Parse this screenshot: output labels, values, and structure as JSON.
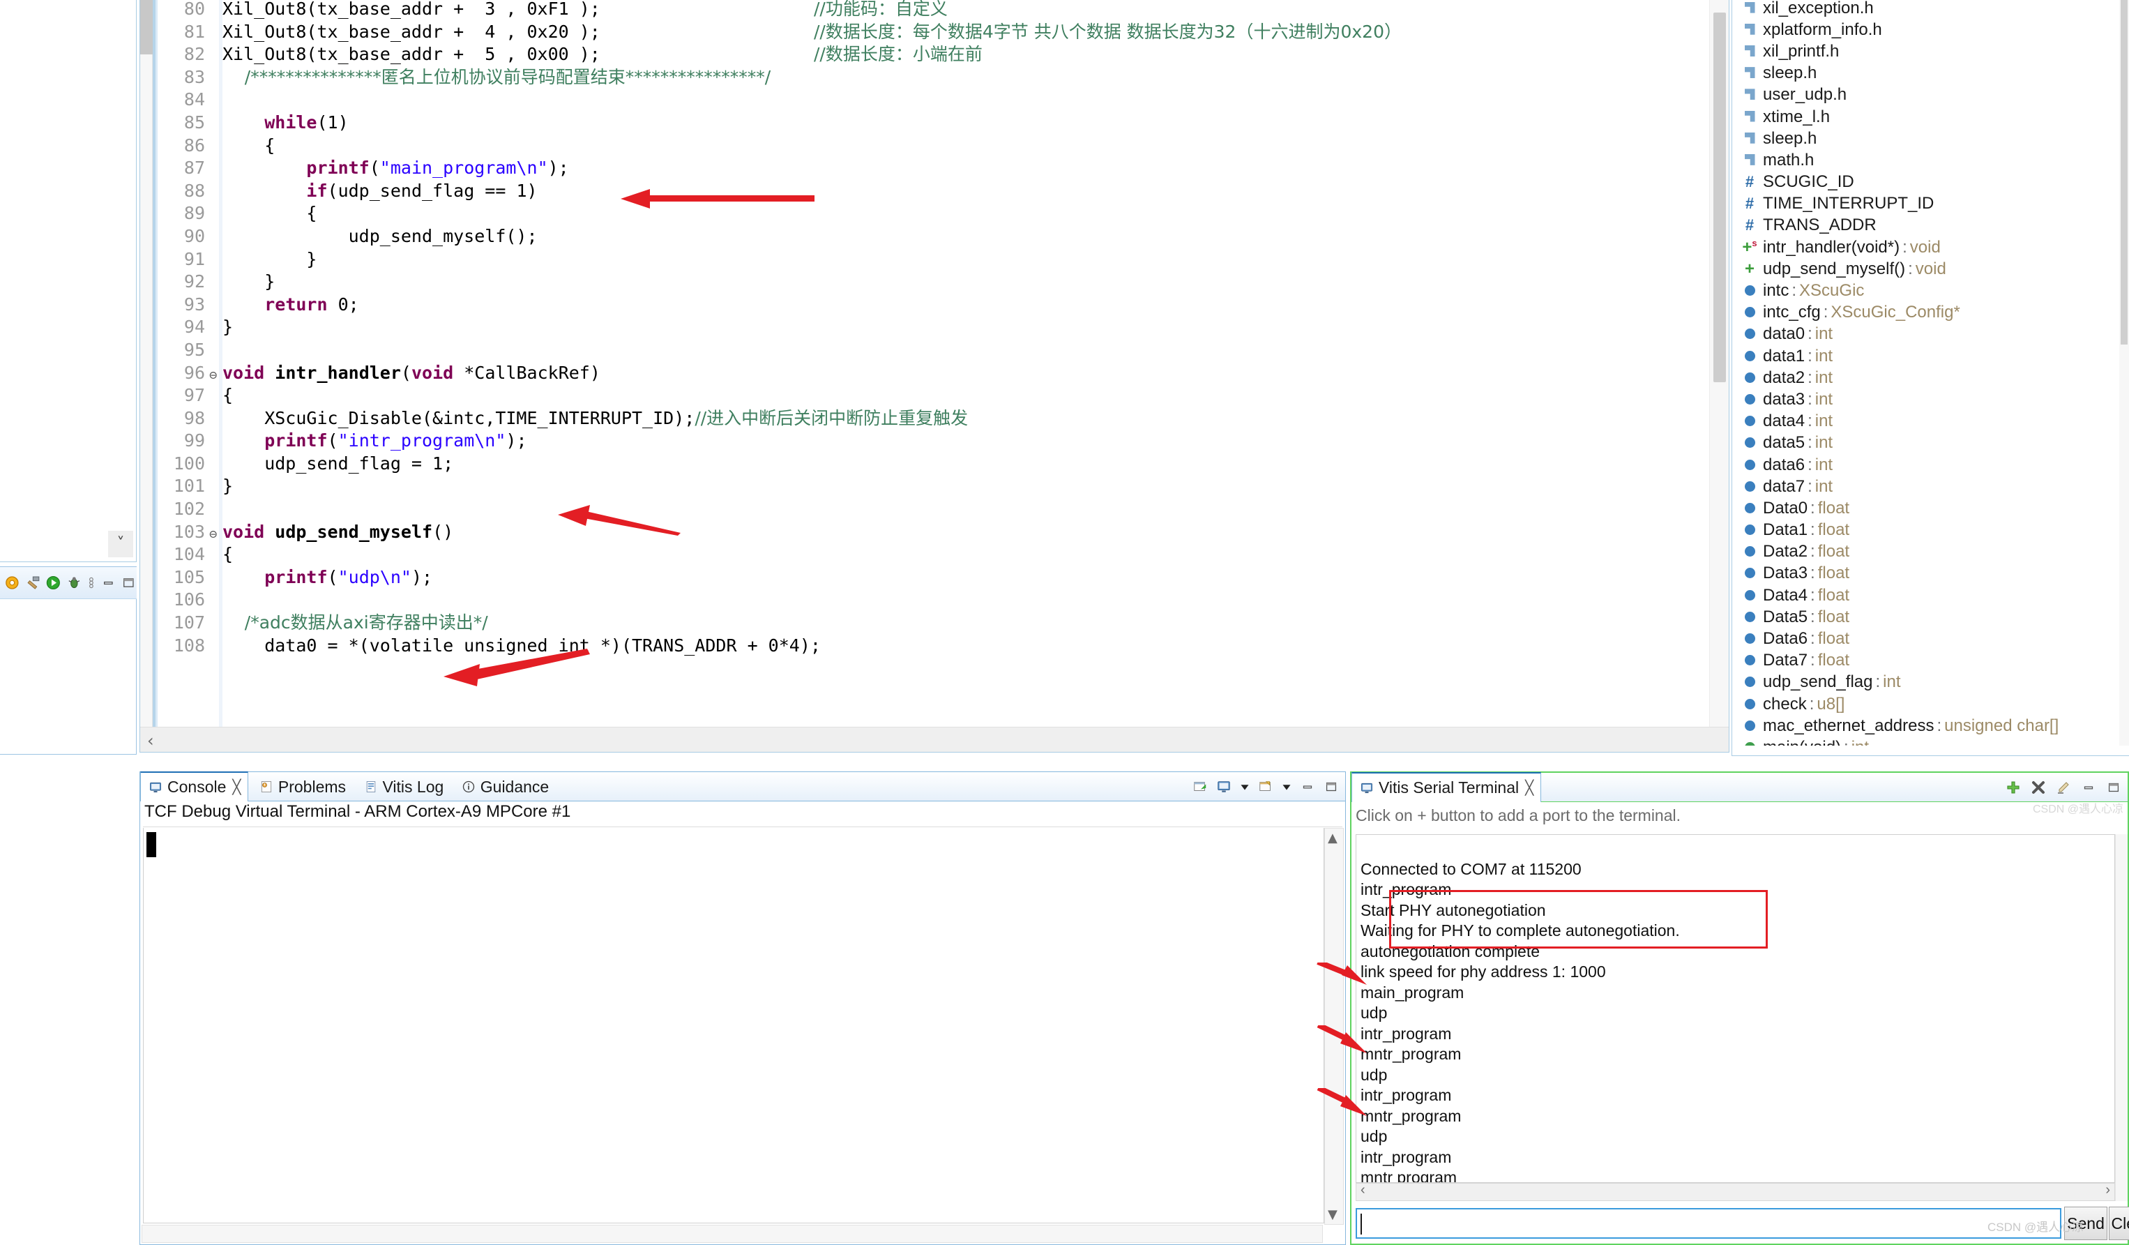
{
  "editor": {
    "lines": [
      {
        "num": "80",
        "fold": "",
        "segments": [
          {
            "t": "Xil_Out8(tx_base_addr +  3 , 0xF1 );",
            "c": "plain"
          }
        ],
        "comment": "//功能码：自定义"
      },
      {
        "num": "81",
        "fold": "",
        "segments": [
          {
            "t": "Xil_Out8(tx_base_addr +  4 , 0x20 );",
            "c": "plain"
          }
        ],
        "comment": "//数据长度：每个数据4字节 共八个数据 数据长度为32（十六进制为0x20）"
      },
      {
        "num": "82",
        "fold": "",
        "segments": [
          {
            "t": "Xil_Out8(tx_base_addr +  5 , 0x00 );",
            "c": "plain"
          }
        ],
        "comment": "//数据长度：小端在前"
      },
      {
        "num": "83",
        "fold": "",
        "segments": [
          {
            "t": "    /***************匿名上位机协议前导码配置结束****************/",
            "c": "cmt"
          }
        ],
        "comment": ""
      },
      {
        "num": "84",
        "fold": "",
        "segments": [],
        "comment": ""
      },
      {
        "num": "85",
        "fold": "",
        "segments": [
          {
            "t": "    ",
            "c": "plain"
          },
          {
            "t": "while",
            "c": "kw"
          },
          {
            "t": "(1)",
            "c": "plain"
          }
        ],
        "comment": ""
      },
      {
        "num": "86",
        "fold": "",
        "segments": [
          {
            "t": "    {",
            "c": "plain"
          }
        ],
        "comment": ""
      },
      {
        "num": "87",
        "fold": "",
        "segments": [
          {
            "t": "        ",
            "c": "plain"
          },
          {
            "t": "printf",
            "c": "kw"
          },
          {
            "t": "(",
            "c": "plain"
          },
          {
            "t": "\"main_program\\n\"",
            "c": "str"
          },
          {
            "t": ");",
            "c": "plain"
          }
        ],
        "comment": ""
      },
      {
        "num": "88",
        "fold": "",
        "segments": [
          {
            "t": "        ",
            "c": "plain"
          },
          {
            "t": "if",
            "c": "kw"
          },
          {
            "t": "(udp_send_flag == 1)",
            "c": "plain"
          }
        ],
        "comment": ""
      },
      {
        "num": "89",
        "fold": "",
        "segments": [
          {
            "t": "        {",
            "c": "plain"
          }
        ],
        "comment": ""
      },
      {
        "num": "90",
        "fold": "",
        "segments": [
          {
            "t": "            udp_send_myself();",
            "c": "plain"
          }
        ],
        "comment": ""
      },
      {
        "num": "91",
        "fold": "",
        "segments": [
          {
            "t": "        }",
            "c": "plain"
          }
        ],
        "comment": ""
      },
      {
        "num": "92",
        "fold": "",
        "segments": [
          {
            "t": "    }",
            "c": "plain"
          }
        ],
        "comment": ""
      },
      {
        "num": "93",
        "fold": "",
        "segments": [
          {
            "t": "    ",
            "c": "plain"
          },
          {
            "t": "return",
            "c": "kw"
          },
          {
            "t": " 0;",
            "c": "plain"
          }
        ],
        "comment": ""
      },
      {
        "num": "94",
        "fold": "",
        "segments": [
          {
            "t": "}",
            "c": "plain"
          }
        ],
        "comment": ""
      },
      {
        "num": "95",
        "fold": "",
        "segments": [],
        "comment": ""
      },
      {
        "num": "96",
        "fold": "⊖",
        "segments": [
          {
            "t": "void",
            "c": "kw"
          },
          {
            "t": " ",
            "c": "plain"
          },
          {
            "t": "intr_handler",
            "c": "bold"
          },
          {
            "t": "(",
            "c": "plain"
          },
          {
            "t": "void",
            "c": "kw"
          },
          {
            "t": " *CallBackRef)",
            "c": "plain"
          }
        ],
        "comment": ""
      },
      {
        "num": "97",
        "fold": "",
        "segments": [
          {
            "t": "{",
            "c": "plain"
          }
        ],
        "comment": ""
      },
      {
        "num": "98",
        "fold": "",
        "segments": [
          {
            "t": "    XScuGic_Disable(&intc,TIME_INTERRUPT_ID);",
            "c": "plain"
          },
          {
            "t": "//进入中断后关闭中断防止重复触发",
            "c": "cmt"
          }
        ],
        "comment": ""
      },
      {
        "num": "99",
        "fold": "",
        "segments": [
          {
            "t": "    ",
            "c": "plain"
          },
          {
            "t": "printf",
            "c": "kw"
          },
          {
            "t": "(",
            "c": "plain"
          },
          {
            "t": "\"intr_program\\n\"",
            "c": "str"
          },
          {
            "t": ");",
            "c": "plain"
          }
        ],
        "comment": ""
      },
      {
        "num": "100",
        "fold": "",
        "segments": [
          {
            "t": "    udp_send_flag = 1;",
            "c": "plain"
          }
        ],
        "comment": ""
      },
      {
        "num": "101",
        "fold": "",
        "segments": [
          {
            "t": "}",
            "c": "plain"
          }
        ],
        "comment": ""
      },
      {
        "num": "102",
        "fold": "",
        "segments": [],
        "comment": ""
      },
      {
        "num": "103",
        "fold": "⊖",
        "segments": [
          {
            "t": "void",
            "c": "kw"
          },
          {
            "t": " ",
            "c": "plain"
          },
          {
            "t": "udp_send_myself",
            "c": "bold"
          },
          {
            "t": "()",
            "c": "plain"
          }
        ],
        "comment": ""
      },
      {
        "num": "104",
        "fold": "",
        "segments": [
          {
            "t": "{",
            "c": "plain"
          }
        ],
        "comment": ""
      },
      {
        "num": "105",
        "fold": "",
        "segments": [
          {
            "t": "    ",
            "c": "plain"
          },
          {
            "t": "printf",
            "c": "kw"
          },
          {
            "t": "(",
            "c": "plain"
          },
          {
            "t": "\"udp\\n\"",
            "c": "str"
          },
          {
            "t": ");",
            "c": "plain"
          }
        ],
        "comment": ""
      },
      {
        "num": "106",
        "fold": "",
        "segments": [],
        "comment": ""
      },
      {
        "num": "107",
        "fold": "",
        "segments": [
          {
            "t": "    /*adc数据从axi寄存器中读出*/",
            "c": "cmt"
          }
        ],
        "comment": ""
      },
      {
        "num": "108",
        "fold": "",
        "segments": [
          {
            "t": "    data0 = *(volatile unsigned int *)(TRANS_ADDR + 0*4);",
            "c": "plain"
          }
        ],
        "comment": ""
      }
    ]
  },
  "outline": {
    "items": [
      {
        "icon": "header-icon",
        "name": "xil_exception.h",
        "type": ""
      },
      {
        "icon": "header-icon",
        "name": "xplatform_info.h",
        "type": ""
      },
      {
        "icon": "header-icon",
        "name": "xil_printf.h",
        "type": ""
      },
      {
        "icon": "header-icon",
        "name": "sleep.h",
        "type": ""
      },
      {
        "icon": "header-icon",
        "name": "user_udp.h",
        "type": ""
      },
      {
        "icon": "header-icon",
        "name": "xtime_l.h",
        "type": ""
      },
      {
        "icon": "header-icon",
        "name": "sleep.h",
        "type": ""
      },
      {
        "icon": "header-icon",
        "name": "math.h",
        "type": ""
      },
      {
        "icon": "define-icon",
        "name": "SCUGIC_ID",
        "type": ""
      },
      {
        "icon": "define-icon",
        "name": "TIME_INTERRUPT_ID",
        "type": ""
      },
      {
        "icon": "define-icon",
        "name": "TRANS_ADDR",
        "type": ""
      },
      {
        "icon": "function-static-icon",
        "name": "intr_handler(void*)",
        "type": "void"
      },
      {
        "icon": "function-icon",
        "name": "udp_send_myself()",
        "type": "void"
      },
      {
        "icon": "variable-icon",
        "name": "intc",
        "type": "XScuGic"
      },
      {
        "icon": "variable-icon",
        "name": "intc_cfg",
        "type": "XScuGic_Config*"
      },
      {
        "icon": "variable-icon",
        "name": "data0",
        "type": "int"
      },
      {
        "icon": "variable-icon",
        "name": "data1",
        "type": "int"
      },
      {
        "icon": "variable-icon",
        "name": "data2",
        "type": "int"
      },
      {
        "icon": "variable-icon",
        "name": "data3",
        "type": "int"
      },
      {
        "icon": "variable-icon",
        "name": "data4",
        "type": "int"
      },
      {
        "icon": "variable-icon",
        "name": "data5",
        "type": "int"
      },
      {
        "icon": "variable-icon",
        "name": "data6",
        "type": "int"
      },
      {
        "icon": "variable-icon",
        "name": "data7",
        "type": "int"
      },
      {
        "icon": "variable-icon",
        "name": "Data0",
        "type": "float"
      },
      {
        "icon": "variable-icon",
        "name": "Data1",
        "type": "float"
      },
      {
        "icon": "variable-icon",
        "name": "Data2",
        "type": "float"
      },
      {
        "icon": "variable-icon",
        "name": "Data3",
        "type": "float"
      },
      {
        "icon": "variable-icon",
        "name": "Data4",
        "type": "float"
      },
      {
        "icon": "variable-icon",
        "name": "Data5",
        "type": "float"
      },
      {
        "icon": "variable-icon",
        "name": "Data6",
        "type": "float"
      },
      {
        "icon": "variable-icon",
        "name": "Data7",
        "type": "float"
      },
      {
        "icon": "variable-icon",
        "name": "udp_send_flag",
        "type": "int"
      },
      {
        "icon": "variable-icon",
        "name": "check",
        "type": "u8[]"
      },
      {
        "icon": "variable-icon",
        "name": "mac_ethernet_address",
        "type": "unsigned char[]"
      },
      {
        "icon": "function-main-icon",
        "name": "main(void)",
        "type": "int"
      }
    ]
  },
  "console": {
    "tabs": [
      {
        "label": "Console",
        "icon": "console-icon",
        "active": true,
        "closable": true
      },
      {
        "label": "Problems",
        "icon": "problems-icon",
        "active": false,
        "closable": false
      },
      {
        "label": "Vitis Log",
        "icon": "log-icon",
        "active": false,
        "closable": false
      },
      {
        "label": "Guidance",
        "icon": "info-icon",
        "active": false,
        "closable": false
      }
    ],
    "subtitle": "TCF Debug Virtual Terminal - ARM Cortex-A9 MPCore #1",
    "body_text": "",
    "toolbar_icons": [
      "terminate-icon",
      "display-console-icon",
      "display-console-dropdown-icon",
      "open-console-icon",
      "open-console-dropdown-icon",
      "minimize-icon",
      "maximize-icon"
    ]
  },
  "left_panel": {
    "toolbar_icons": [
      "settings-icon",
      "build-icon",
      "run-icon",
      "debug-icon",
      "menu-icon",
      "minimize-icon",
      "maximize-icon"
    ],
    "collapse_icon": "chevron-down-icon"
  },
  "serial": {
    "tab": {
      "label": "Vitis Serial Terminal",
      "icon": "terminal-icon",
      "closable": true
    },
    "hint": "Click on + button to add a port to the terminal.",
    "output_lines": [
      "",
      "Connected to COM7 at 115200",
      "intr_program",
      "Start PHY autonegotiation",
      "Waiting for PHY to complete autonegotiation.",
      "autonegotiation complete",
      "link speed for phy address 1: 1000",
      "main_program",
      "udp",
      "intr_program",
      "mntr_program",
      "udp",
      "intr_program",
      "mntr_program",
      "udp",
      "intr_program",
      "mntr program"
    ],
    "input_value": "",
    "send_label": "Send",
    "clear_label": "Clear",
    "toolbar_icons": [
      "add-port-icon",
      "disconnect-icon",
      "clear-terminal-icon",
      "minimize-icon",
      "maximize-icon"
    ]
  },
  "annotations": {
    "highlight_box_label": "phy-autonegotiation-highlight",
    "arrow_color": "#e31e24",
    "box_color": "#e31e24"
  },
  "watermark": {
    "text": "CSDN @遇人心凉",
    "text2": "CSDN @遇人心凉"
  }
}
